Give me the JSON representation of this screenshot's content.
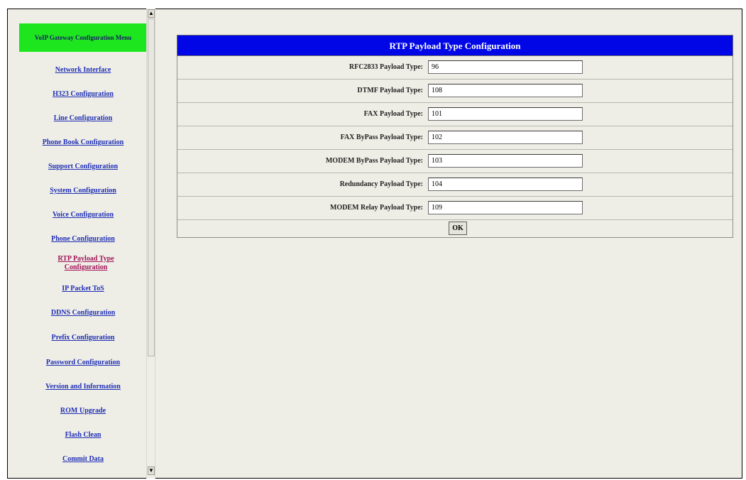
{
  "menu": {
    "header": "VoIP Gateway Configuration Menu",
    "items": [
      {
        "label": "Network Interface"
      },
      {
        "label": "H323 Configuration"
      },
      {
        "label": "Line Configuration"
      },
      {
        "label": "Phone Book Configuration"
      },
      {
        "label": "Support Configuration"
      },
      {
        "label": "System Configuration"
      },
      {
        "label": "Voice Configuration"
      },
      {
        "label": "Phone Configuration"
      },
      {
        "label": "RTP Payload Type Configuration",
        "active": true
      },
      {
        "label": "IP Packet ToS"
      },
      {
        "label": "DDNS Configuration"
      },
      {
        "label": "Prefix Configuration"
      },
      {
        "label": "Password Configuration"
      },
      {
        "label": "Version and Information"
      },
      {
        "label": "ROM Upgrade"
      },
      {
        "label": "Flash Clean"
      },
      {
        "label": "Commit Data"
      }
    ]
  },
  "page": {
    "title": "RTP Payload Type Configuration",
    "fields": [
      {
        "label": "RFC2833 Payload Type:",
        "value": "96"
      },
      {
        "label": "DTMF Payload Type:",
        "value": "108"
      },
      {
        "label": "FAX Payload Type:",
        "value": "101"
      },
      {
        "label": "FAX ByPass Payload Type:",
        "value": "102"
      },
      {
        "label": "MODEM ByPass Payload Type:",
        "value": "103"
      },
      {
        "label": "Redundancy Payload Type:",
        "value": "104"
      },
      {
        "label": "MODEM Relay Payload Type:",
        "value": "109"
      }
    ],
    "ok_label": "OK"
  },
  "scrollbar": {
    "up_glyph": "▲",
    "down_glyph": "▼"
  },
  "colors": {
    "menu_header_bg": "#1ee61e",
    "title_bar_bg": "#0006e6",
    "link": "#1f2fb5",
    "active_link": "#a0145a"
  }
}
